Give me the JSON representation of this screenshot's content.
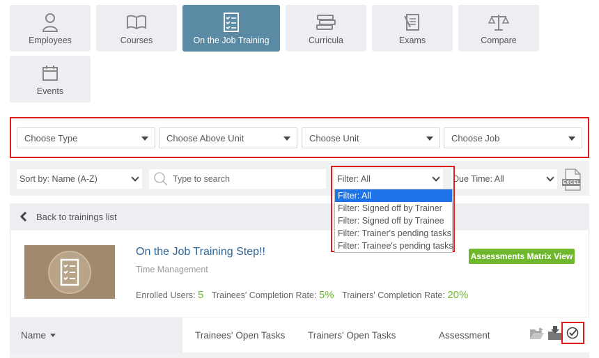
{
  "nav": {
    "tiles": [
      {
        "label": "Employees",
        "icon": "user-icon"
      },
      {
        "label": "Courses",
        "icon": "book-open-icon"
      },
      {
        "label": "On the Job Training",
        "icon": "checklist-icon",
        "active": true
      },
      {
        "label": "Curricula",
        "icon": "books-stack-icon"
      },
      {
        "label": "Exams",
        "icon": "exam-icon"
      },
      {
        "label": "Compare",
        "icon": "scale-icon"
      },
      {
        "label": "Events",
        "icon": "calendar-icon"
      }
    ]
  },
  "filters": {
    "type": "Choose Type",
    "above_unit": "Choose Above Unit",
    "unit": "Choose Unit",
    "job": "Choose Job"
  },
  "toolbar": {
    "sort": "Sort by: Name (A-Z)",
    "search_placeholder": "Type to search",
    "filter": "Filter: All",
    "due_time": "Due Time: All",
    "excel_label": "EXCEL"
  },
  "filter_dropdown": {
    "options": [
      "Filter: All",
      "Filter: Signed off by Trainer",
      "Filter: Signed off by Trainee",
      "Filter: Trainer's pending tasks",
      "Filter: Trainee's pending tasks"
    ],
    "selected_index": 0
  },
  "back_link": "Back to trainings list",
  "training": {
    "title": "On the Job Training Step!!",
    "subtitle": "Time Management",
    "enrolled_label": "Enrolled Users:",
    "enrolled_value": "5",
    "trainees_rate_label": "Trainees' Completion Rate:",
    "trainees_rate_value": "5%",
    "trainers_rate_label": "Trainers' Completion Rate:",
    "trainers_rate_value": "20%",
    "matrix_button": "Assessments Matrix View"
  },
  "table": {
    "headers": {
      "name": "Name",
      "trainees_open": "Trainees' Open Tasks",
      "trainers_open": "Trainers' Open Tasks",
      "assessment": "Assessment"
    }
  },
  "colors": {
    "active_tile": "#5b8aa4",
    "highlight": "#e01b1b",
    "accent_green": "#6fb82d",
    "title_blue": "#2f6496"
  }
}
